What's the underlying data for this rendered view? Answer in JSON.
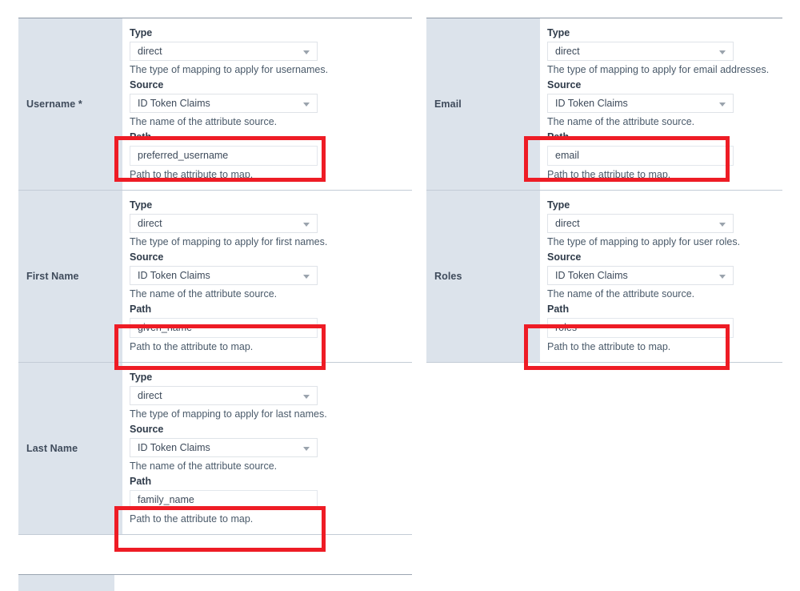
{
  "annotation": {
    "highlight_color": "#ee1c25",
    "highlight_count": 5
  },
  "field_labels": {
    "type": "Type",
    "source": "Source",
    "path": "Path"
  },
  "help_text": {
    "source": "The name of the attribute source.",
    "path": "Path to the attribute to map."
  },
  "icons": {
    "dropdown": "chevron-down-icon"
  },
  "tables": {
    "left": {
      "rows": [
        {
          "label": "Username *",
          "type_value": "direct",
          "type_help": "The type of mapping to apply for usernames.",
          "source_value": "ID Token Claims",
          "source_help": "The name of the attribute source.",
          "path_value": "preferred_username",
          "path_help": "Path to the attribute to map.",
          "highlighted": true
        },
        {
          "label": "First Name",
          "type_value": "direct",
          "type_help": "The type of mapping to apply for first names.",
          "source_value": "ID Token Claims",
          "source_help": "The name of the attribute source.",
          "path_value": "given_name",
          "path_help": "Path to the attribute to map.",
          "highlighted": true
        },
        {
          "label": "Last Name",
          "type_value": "direct",
          "type_help": "The type of mapping to apply for last names.",
          "source_value": "ID Token Claims",
          "source_help": "The name of the attribute source.",
          "path_value": "family_name",
          "path_help": "Path to the attribute to map.",
          "highlighted": true
        }
      ]
    },
    "right": {
      "rows": [
        {
          "label": "Email",
          "type_value": "direct",
          "type_help": "The type of mapping to apply for email addresses.",
          "source_value": "ID Token Claims",
          "source_help": "The name of the attribute source.",
          "path_value": "email",
          "path_help": "Path to the attribute to map.",
          "highlighted": true
        },
        {
          "label": "Roles",
          "type_value": "direct",
          "type_help": "The type of mapping to apply for user roles.",
          "source_value": "ID Token Claims",
          "source_help": "The name of the attribute source.",
          "path_value": "roles",
          "path_help": "Path to the attribute to map.",
          "highlighted": true
        }
      ]
    }
  }
}
